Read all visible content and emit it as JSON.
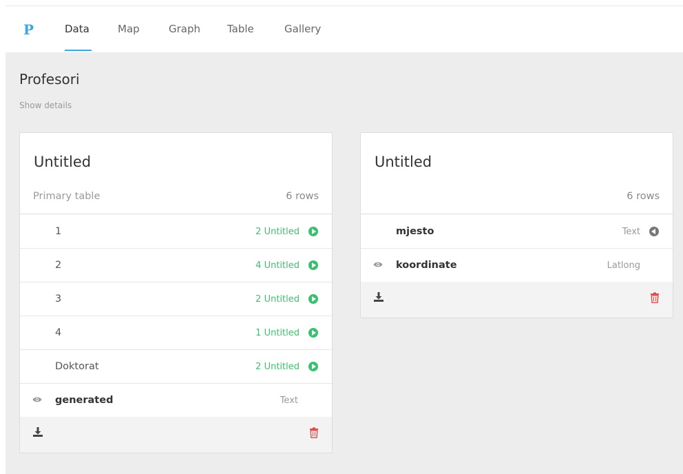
{
  "nav": {
    "logo": "P",
    "tabs": [
      {
        "label": "Data",
        "active": true
      },
      {
        "label": "Map",
        "active": false
      },
      {
        "label": "Graph",
        "active": false
      },
      {
        "label": "Table",
        "active": false
      },
      {
        "label": "Gallery",
        "active": false
      }
    ]
  },
  "page": {
    "title": "Profesori",
    "show_details": "Show details"
  },
  "cards": [
    {
      "title": "Untitled",
      "primary_label": "Primary table",
      "rows_count": "6 rows",
      "rows": [
        {
          "label": "1",
          "link": "2 Untitled"
        },
        {
          "label": "2",
          "link": "4 Untitled"
        },
        {
          "label": "3",
          "link": "2 Untitled"
        },
        {
          "label": "4",
          "link": "1 Untitled"
        },
        {
          "label": "Doktorat",
          "link": "2 Untitled"
        }
      ],
      "generated": {
        "label": "generated",
        "type": "Text"
      }
    },
    {
      "title": "Untitled",
      "rows_count": "6 rows",
      "rows": [
        {
          "label": "mjesto",
          "type": "Text"
        },
        {
          "label": "koordinate",
          "type": "Latlong"
        }
      ]
    }
  ],
  "colors": {
    "accent": "#3aa8e0",
    "link_green": "#3cbf6e",
    "delete_red": "#e04848",
    "background": "#ededed"
  },
  "icons": {
    "eye": "eye-icon",
    "arrow_right": "arrow-circle-right-icon",
    "arrow_left": "arrow-circle-left-icon",
    "download": "download-icon",
    "trash": "trash-icon"
  }
}
